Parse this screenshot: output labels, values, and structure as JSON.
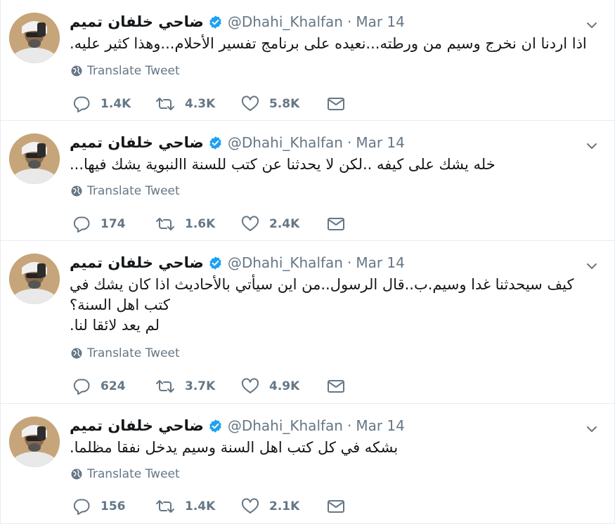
{
  "colors": {
    "accent": "#1da1f2",
    "muted": "#657786",
    "text": "#14171a",
    "border": "#e6ecf0"
  },
  "labels": {
    "translate": "Translate Tweet"
  },
  "icons": {
    "verified": "verified-badge-icon",
    "globe": "globe-icon",
    "reply": "reply-icon",
    "retweet": "retweet-icon",
    "like": "heart-icon",
    "dm": "envelope-icon",
    "menu": "chevron-down-icon"
  },
  "tweets": [
    {
      "name": "ضاحي خلفان تميم",
      "handle": "@Dhahi_Khalfan",
      "dot": "·",
      "time": "Mar 14",
      "text": "اذا اردنا ان نخرج وسيم من ورطته...نعيده على برنامج تفسير الأحلام...وهذا كثير عليه.",
      "replies": "1.4K",
      "retweets": "4.3K",
      "likes": "5.8K"
    },
    {
      "name": "ضاحي خلفان تميم",
      "handle": "@Dhahi_Khalfan",
      "dot": "·",
      "time": "Mar 14",
      "text": "خله يشك على كيفه ..لكن لا يحدثنا عن كتب للسنة االنبوية يشك فيها...",
      "replies": "174",
      "retweets": "1.6K",
      "likes": "2.4K"
    },
    {
      "name": "ضاحي خلفان تميم",
      "handle": "@Dhahi_Khalfan",
      "dot": "·",
      "time": "Mar 14",
      "text": "كيف سيحدثنا غدا وسيم.ب..قال الرسول..من اين سيأتي بالأحاديث اذا كان يشك في كتب اهل السنة؟\nلم يعد لائقا لنا.",
      "replies": "624",
      "retweets": "3.7K",
      "likes": "4.9K"
    },
    {
      "name": "ضاحي خلفان تميم",
      "handle": "@Dhahi_Khalfan",
      "dot": "·",
      "time": "Mar 14",
      "text": "بشكه في كل كتب اهل السنة وسيم يدخل نفقا مظلما.",
      "replies": "156",
      "retweets": "1.4K",
      "likes": "2.1K"
    }
  ]
}
